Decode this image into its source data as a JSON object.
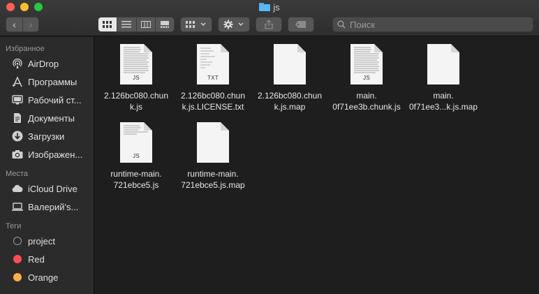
{
  "window": {
    "title": "js"
  },
  "toolbar": {
    "back_glyph": "‹",
    "forward_glyph": "›",
    "search_placeholder": "Поиск"
  },
  "sidebar": {
    "favorites_title": "Избранное",
    "favorites": [
      {
        "label": "AirDrop",
        "icon": "airdrop-icon"
      },
      {
        "label": "Программы",
        "icon": "applications-icon"
      },
      {
        "label": "Рабочий ст...",
        "icon": "desktop-icon"
      },
      {
        "label": "Документы",
        "icon": "documents-icon"
      },
      {
        "label": "Загрузки",
        "icon": "downloads-icon"
      },
      {
        "label": "Изображен...",
        "icon": "pictures-icon"
      }
    ],
    "locations_title": "Места",
    "locations": [
      {
        "label": "iCloud Drive",
        "icon": "icloud-icon"
      },
      {
        "label": "Валерий's...",
        "icon": "laptop-icon"
      }
    ],
    "tags_title": "Теги",
    "tags": [
      {
        "label": "project",
        "color": "#2b2b2b"
      },
      {
        "label": "Red",
        "color": "#fe4d55"
      },
      {
        "label": "Orange",
        "color": "#fdad4a"
      }
    ]
  },
  "files": [
    {
      "line1": "2.126bc080.chun",
      "line2": "k.js",
      "ext": "JS",
      "lined": true
    },
    {
      "line1": "2.126bc080.chun",
      "line2": "k.js.LICENSE.txt",
      "ext": "TXT",
      "lined": true
    },
    {
      "line1": "2.126bc080.chun",
      "line2": "k.js.map",
      "ext": "",
      "lined": false
    },
    {
      "line1": "main.",
      "line2": "0f71ee3b.chunk.js",
      "ext": "JS",
      "lined": true
    },
    {
      "line1": "main.",
      "line2": "0f71ee3...k.js.map",
      "ext": "",
      "lined": false
    },
    {
      "line1": "runtime-main.",
      "line2": "721ebce5.js",
      "ext": "JS",
      "lined": true
    },
    {
      "line1": "runtime-main.",
      "line2": "721ebce5.js.map",
      "ext": "",
      "lined": false
    }
  ]
}
